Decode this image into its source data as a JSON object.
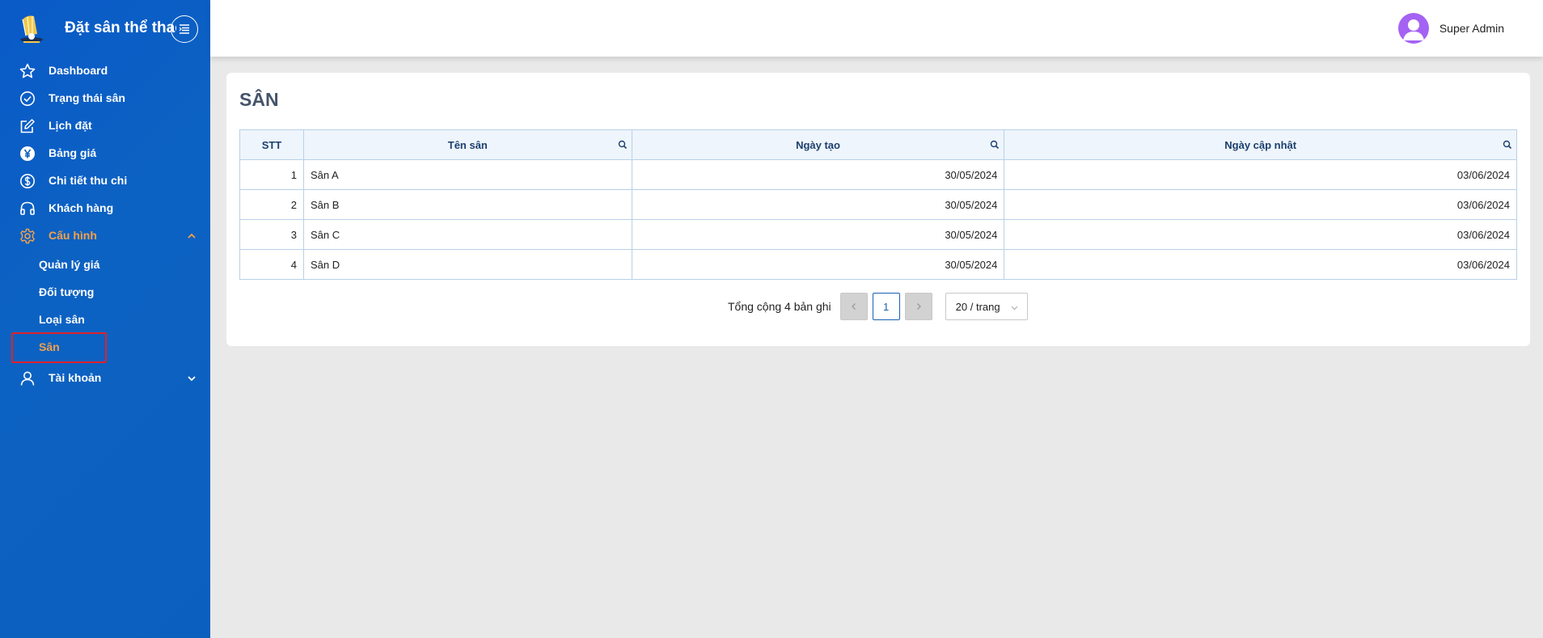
{
  "app": {
    "title": "Đặt sân thể thao",
    "logo_icon": "badminton-shuttle-logo"
  },
  "sidebar": {
    "items": [
      {
        "label": "Dashboard",
        "icon": "star-icon"
      },
      {
        "label": "Trạng thái sân",
        "icon": "check-circle-icon"
      },
      {
        "label": "Lịch đặt",
        "icon": "edit-icon"
      },
      {
        "label": "Bảng giá",
        "icon": "yen-icon"
      },
      {
        "label": "Chi tiết thu chi",
        "icon": "dollar-circle-icon"
      },
      {
        "label": "Khách hàng",
        "icon": "headset-icon"
      },
      {
        "label": "Cấu hình",
        "icon": "gear-icon",
        "expanded": true
      },
      {
        "label": "Tài khoản",
        "icon": "user-icon",
        "expanded": false
      }
    ],
    "submenu": [
      {
        "label": "Quản lý giá"
      },
      {
        "label": "Đối tượng"
      },
      {
        "label": "Loại sân"
      },
      {
        "label": "Sân",
        "selected": true
      }
    ],
    "active_color": "#f5a04a"
  },
  "header": {
    "user_name": "Super Admin",
    "avatar_color": "#a463f2"
  },
  "main": {
    "title": "SÂN",
    "table": {
      "columns": [
        "STT",
        "Tên sân",
        "Ngày tạo",
        "Ngày cập nhật"
      ],
      "rows": [
        {
          "stt": "1",
          "name": "Sân A",
          "created": "30/05/2024",
          "updated": "03/06/2024"
        },
        {
          "stt": "2",
          "name": "Sân B",
          "created": "30/05/2024",
          "updated": "03/06/2024"
        },
        {
          "stt": "3",
          "name": "Sân C",
          "created": "30/05/2024",
          "updated": "03/06/2024"
        },
        {
          "stt": "4",
          "name": "Sân D",
          "created": "30/05/2024",
          "updated": "03/06/2024"
        }
      ]
    },
    "pagination": {
      "total_text": "Tổng cộng 4 bản ghi",
      "current_page": "1",
      "page_size": "20 / trang"
    }
  }
}
